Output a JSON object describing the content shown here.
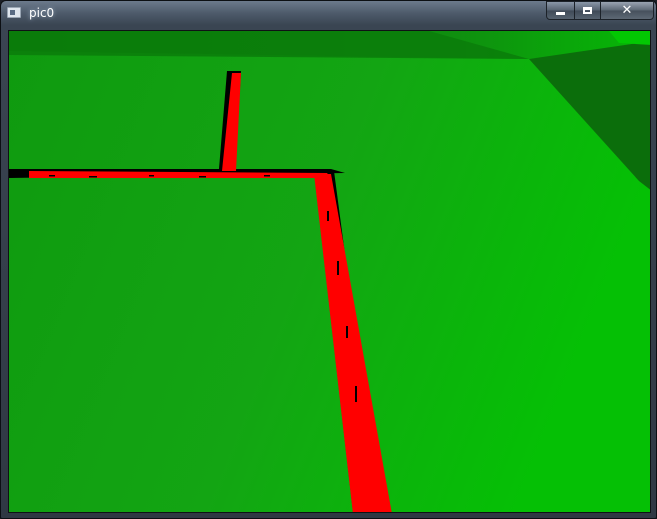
{
  "window": {
    "title": "pic0",
    "app_icon": "window-app-icon"
  },
  "controls": {
    "minimize_icon": "minimize-icon",
    "maximize_icon": "maximize-icon",
    "close_icon": "close-icon",
    "close_glyph": "✕"
  },
  "canvas": {
    "content": "camera-view",
    "colors": {
      "floor": "#12a312",
      "floor_bright": "#04c404",
      "back_wall": "#0d8a0d",
      "right_wall": "#0b6e0b",
      "line": "#ff0000",
      "line_shadow": "#000000"
    }
  }
}
